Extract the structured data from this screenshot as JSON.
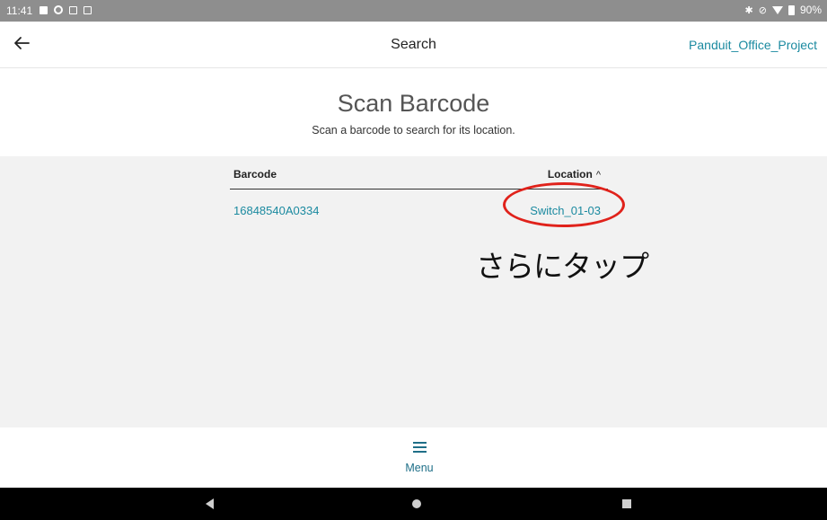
{
  "status_bar": {
    "time": "11:41",
    "battery": "90%",
    "left_icons": [
      "image-icon",
      "settings-icon",
      "screen-icon",
      "screen-icon"
    ],
    "right_icons": [
      "bluetooth-icon",
      "mute-icon",
      "wifi-icon",
      "battery-icon"
    ]
  },
  "app_bar": {
    "title": "Search",
    "project": "Panduit_Office_Project"
  },
  "header": {
    "title": "Scan Barcode",
    "subtitle": "Scan a barcode to search for its location."
  },
  "table": {
    "columns": {
      "barcode": "Barcode",
      "location": "Location"
    },
    "sort_indicator": "^",
    "rows": [
      {
        "barcode": "16848540A0334",
        "location": "Switch_01-03"
      }
    ]
  },
  "annotation": {
    "text": "さらにタップ",
    "color": "#e0221b"
  },
  "menu": {
    "label": "Menu"
  },
  "colors": {
    "accent": "#1b8aa0",
    "status_bar": "#8e8e8e",
    "content_bg": "#f2f2f2"
  }
}
